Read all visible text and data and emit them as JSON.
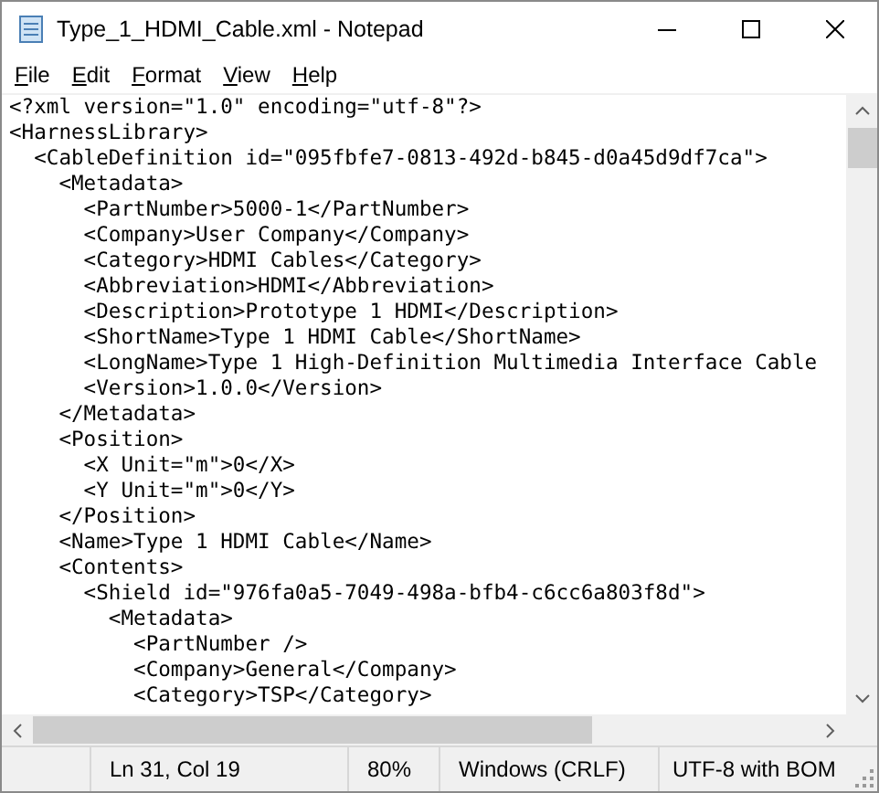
{
  "window": {
    "title": "Type_1_HDMI_Cable.xml - Notepad"
  },
  "menu": [
    "File",
    "Edit",
    "Format",
    "View",
    "Help"
  ],
  "editor": {
    "lines": [
      "<?xml version=\"1.0\" encoding=\"utf-8\"?>",
      "<HarnessLibrary>",
      "  <CableDefinition id=\"095fbfe7-0813-492d-b845-d0a45d9df7ca\">",
      "    <Metadata>",
      "      <PartNumber>5000-1</PartNumber>",
      "      <Company>User Company</Company>",
      "      <Category>HDMI Cables</Category>",
      "      <Abbreviation>HDMI</Abbreviation>",
      "      <Description>Prototype 1 HDMI</Description>",
      "      <ShortName>Type 1 HDMI Cable</ShortName>",
      "      <LongName>Type 1 High-Definition Multimedia Interface Cable",
      "      <Version>1.0.0</Version>",
      "    </Metadata>",
      "    <Position>",
      "      <X Unit=\"m\">0</X>",
      "      <Y Unit=\"m\">0</Y>",
      "    </Position>",
      "    <Name>Type 1 HDMI Cable</Name>",
      "    <Contents>",
      "      <Shield id=\"976fa0a5-7049-498a-bfb4-c6cc6a803f8d\">",
      "        <Metadata>",
      "          <PartNumber />",
      "          <Company>General</Company>",
      "          <Category>TSP</Category>"
    ]
  },
  "status_bar": [
    "Ln 31, Col 19",
    "80%",
    "Windows (CRLF)",
    "UTF-8 with BOM"
  ]
}
